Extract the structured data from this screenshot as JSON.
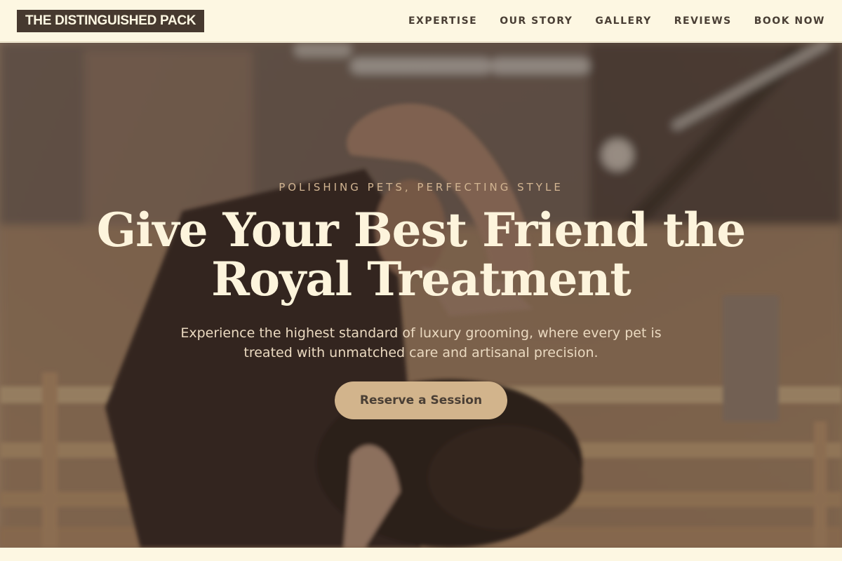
{
  "header": {
    "logo": "THE DISTINGUISHED PACK",
    "nav": [
      {
        "label": "EXPERTISE"
      },
      {
        "label": "OUR STORY"
      },
      {
        "label": "GALLERY"
      },
      {
        "label": "REVIEWS"
      },
      {
        "label": "BOOK NOW"
      }
    ]
  },
  "hero": {
    "tagline": "POLISHING PETS, PERFECTING STYLE",
    "headline": "Give Your Best Friend the Royal Treatment",
    "subtext": "Experience the highest standard of luxury grooming, where every pet is treated with unmatched care and artisanal precision.",
    "cta_label": "Reserve a Session"
  },
  "colors": {
    "header_bg": "#fdf7e2",
    "logo_bg": "#46392f",
    "accent": "#d2b48c",
    "text_dark": "#4a3f35"
  }
}
